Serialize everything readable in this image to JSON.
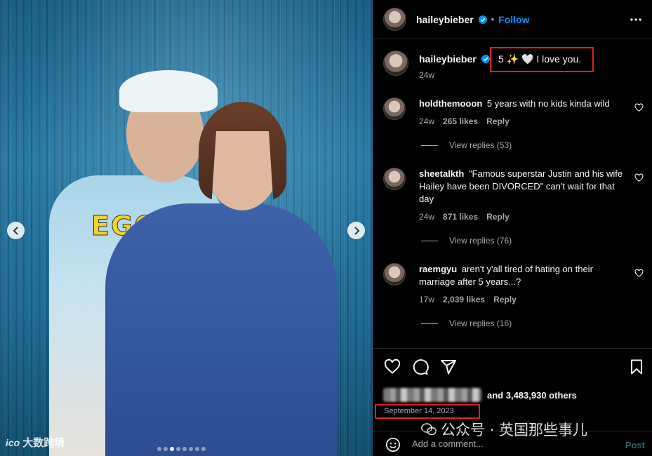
{
  "photo": {
    "nav_prev_icon": "chevron-left-icon",
    "nav_next_icon": "chevron-right-icon",
    "carousel_total": 8,
    "carousel_active": 2,
    "print_text": "EGO",
    "watermark_left": "大数跨境",
    "watermark_left_logo": "ico"
  },
  "header": {
    "username": "haileybieber",
    "separator": "•",
    "follow_label": "Follow",
    "more_icon": "more-horizontal-icon"
  },
  "caption": {
    "username": "haileybieber",
    "text": "5 ✨ 🤍 I love you.",
    "time": "24w"
  },
  "comments": [
    {
      "username": "holdthemooon",
      "text": "5 years with no kids kinda wild",
      "time": "24w",
      "likes": "265 likes",
      "reply_label": "Reply",
      "view_replies": "View replies (53)"
    },
    {
      "username": "sheetalkth",
      "text": "\"Famous superstar Justin and his wife Hailey have been DIVORCED\" can't wait for that day",
      "time": "24w",
      "likes": "871 likes",
      "reply_label": "Reply",
      "view_replies": "View replies (76)"
    },
    {
      "username": "raemgyu",
      "text": "aren't y'all tired of hating on their marriage after 5 years...?",
      "time": "17w",
      "likes": "2,039 likes",
      "reply_label": "Reply",
      "view_replies": "View replies (16)"
    }
  ],
  "likes": {
    "text": "and 3,483,930 others"
  },
  "date": "September 14, 2023",
  "watermark_right": "公众号 · 英国那些事儿",
  "add_comment": {
    "placeholder": "Add a comment...",
    "post_label": "Post"
  },
  "colors": {
    "accent": "#0095f6",
    "highlight": "#e32020",
    "muted": "#a8a8a8"
  }
}
